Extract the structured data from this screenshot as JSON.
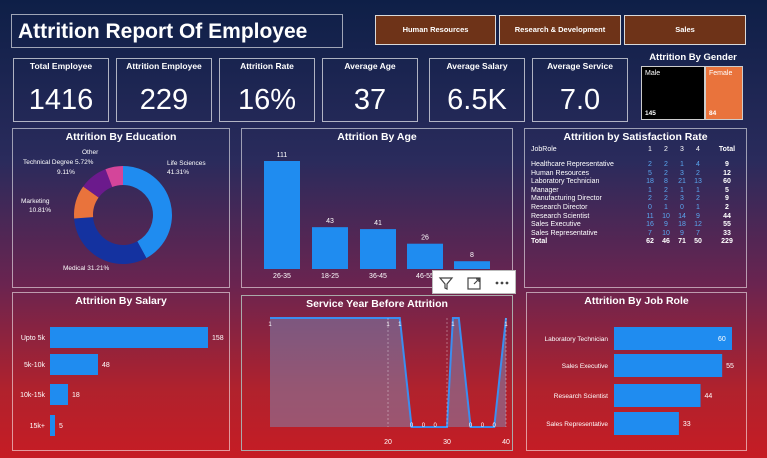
{
  "header": {
    "title": "Attrition Report Of Employee"
  },
  "nav": [
    "Human Resources",
    "Research & Development",
    "Sales"
  ],
  "kpis": [
    {
      "label": "Total Employee",
      "value": "1416"
    },
    {
      "label": "Attrition Employee",
      "value": "229"
    },
    {
      "label": "Attrition Rate",
      "value": "16%"
    },
    {
      "label": "Average Age",
      "value": "37"
    },
    {
      "label": "Average Salary",
      "value": "6.5K"
    },
    {
      "label": "Average Service",
      "value": "7.0"
    }
  ],
  "gender": {
    "title": "Attrition By Gender",
    "male_label": "Male",
    "male_value": "145",
    "female_label": "Female",
    "female_value": "84",
    "colors": {
      "male": "#000000",
      "female": "#e9733c"
    }
  },
  "education": {
    "title": "Attrition By Education",
    "labels": {
      "life": "Life Sciences",
      "life_pct": "41.31%",
      "medical": "Medical 31.21%",
      "marketing": "Marketing",
      "marketing_pct": "10.81%",
      "technical": "Technical Degree 5.72%",
      "other": "Other",
      "other_pct": "9.11%"
    }
  },
  "age": {
    "title": "Attrition By Age"
  },
  "satisfaction": {
    "title": "Attrition by Satisfaction Rate",
    "headers": [
      "JobRole",
      "1",
      "2",
      "3",
      "4",
      "Total"
    ],
    "rows": [
      [
        "Healthcare Representative",
        "2",
        "2",
        "1",
        "4",
        "9"
      ],
      [
        "Human Resources",
        "5",
        "2",
        "3",
        "2",
        "12"
      ],
      [
        "Laboratory Technician",
        "18",
        "8",
        "21",
        "13",
        "60"
      ],
      [
        "Manager",
        "1",
        "2",
        "1",
        "1",
        "5"
      ],
      [
        "Manufacturing Director",
        "2",
        "2",
        "3",
        "2",
        "9"
      ],
      [
        "Research Director",
        "0",
        "1",
        "0",
        "1",
        "2"
      ],
      [
        "Research Scientist",
        "11",
        "10",
        "14",
        "9",
        "44"
      ],
      [
        "Sales Executive",
        "16",
        "9",
        "18",
        "12",
        "55"
      ],
      [
        "Sales Representative",
        "7",
        "10",
        "9",
        "7",
        "33"
      ],
      [
        "Total",
        "62",
        "46",
        "71",
        "50",
        "229"
      ]
    ]
  },
  "salary": {
    "title": "Attrition By Salary"
  },
  "service": {
    "title": "Service Year Before Attrition"
  },
  "jobrole": {
    "title": "Attrition By Job Role"
  },
  "chart_data": [
    {
      "type": "pie",
      "title": "Attrition By Education",
      "categories": [
        "Life Sciences",
        "Medical",
        "Marketing",
        "Technical Degree",
        "Other"
      ],
      "values": [
        41.31,
        31.21,
        10.81,
        9.11,
        5.72
      ],
      "colors": [
        "#1f8cf0",
        "#1432a0",
        "#e9733c",
        "#6b1a8c",
        "#d4459a"
      ]
    },
    {
      "type": "bar",
      "title": "Attrition By Age",
      "categories": [
        "26-35",
        "18-25",
        "36-45",
        "46-55",
        "55+"
      ],
      "values": [
        111,
        43,
        41,
        26,
        8
      ]
    },
    {
      "type": "bar",
      "title": "Attrition By Salary",
      "categories": [
        "Upto 5k",
        "5k-10k",
        "10k-15k",
        "15k+"
      ],
      "values": [
        158,
        48,
        18,
        5
      ]
    },
    {
      "type": "area",
      "title": "Service Year Before Attrition",
      "x": [
        0,
        10,
        20,
        21,
        22,
        24,
        26,
        28,
        30,
        31,
        32,
        34,
        35,
        36,
        37,
        38,
        40
      ],
      "values": [
        1,
        1,
        1,
        1,
        1,
        0,
        0,
        0,
        0,
        1,
        1,
        0,
        0,
        0,
        0,
        0,
        1
      ],
      "xticks": [
        20,
        30,
        40
      ]
    },
    {
      "type": "bar",
      "title": "Attrition By Job Role",
      "categories": [
        "Laboratory Technician",
        "Sales Executive",
        "Research Scientist",
        "Sales Representative"
      ],
      "values": [
        60,
        55,
        44,
        33
      ]
    }
  ]
}
